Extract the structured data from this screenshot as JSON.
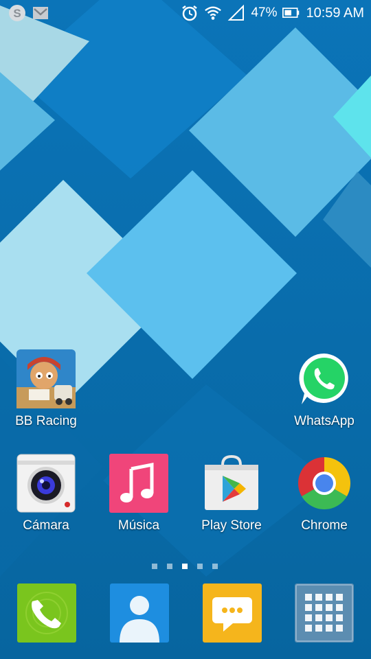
{
  "status_bar": {
    "left_icons": [
      "skype-icon",
      "gmail-icon"
    ],
    "right_icons": [
      "alarm-icon",
      "wifi-icon",
      "signal-icon",
      "battery-icon"
    ],
    "battery_percent": "47%",
    "time": "10:59 AM"
  },
  "home": {
    "apps": [
      {
        "label": "BB Racing",
        "icon": "bb-racing-icon"
      },
      {
        "label": "WhatsApp",
        "icon": "whatsapp-icon"
      },
      {
        "label": "Cámara",
        "icon": "camera-icon"
      },
      {
        "label": "Música",
        "icon": "music-icon"
      },
      {
        "label": "Play Store",
        "icon": "play-store-icon"
      },
      {
        "label": "Chrome",
        "icon": "chrome-icon"
      }
    ],
    "page_indicator": {
      "pages": 5,
      "current": 3
    }
  },
  "dock": {
    "items": [
      {
        "icon": "phone-icon"
      },
      {
        "icon": "contacts-icon"
      },
      {
        "icon": "messages-icon"
      },
      {
        "icon": "app-drawer-icon"
      }
    ]
  },
  "colors": {
    "wallpaper_base": "#0a6fb0",
    "whatsapp_green": "#25d366",
    "music_pink": "#f0457a",
    "phone_green": "#7ac51e",
    "messages_yellow": "#f5b51c"
  }
}
